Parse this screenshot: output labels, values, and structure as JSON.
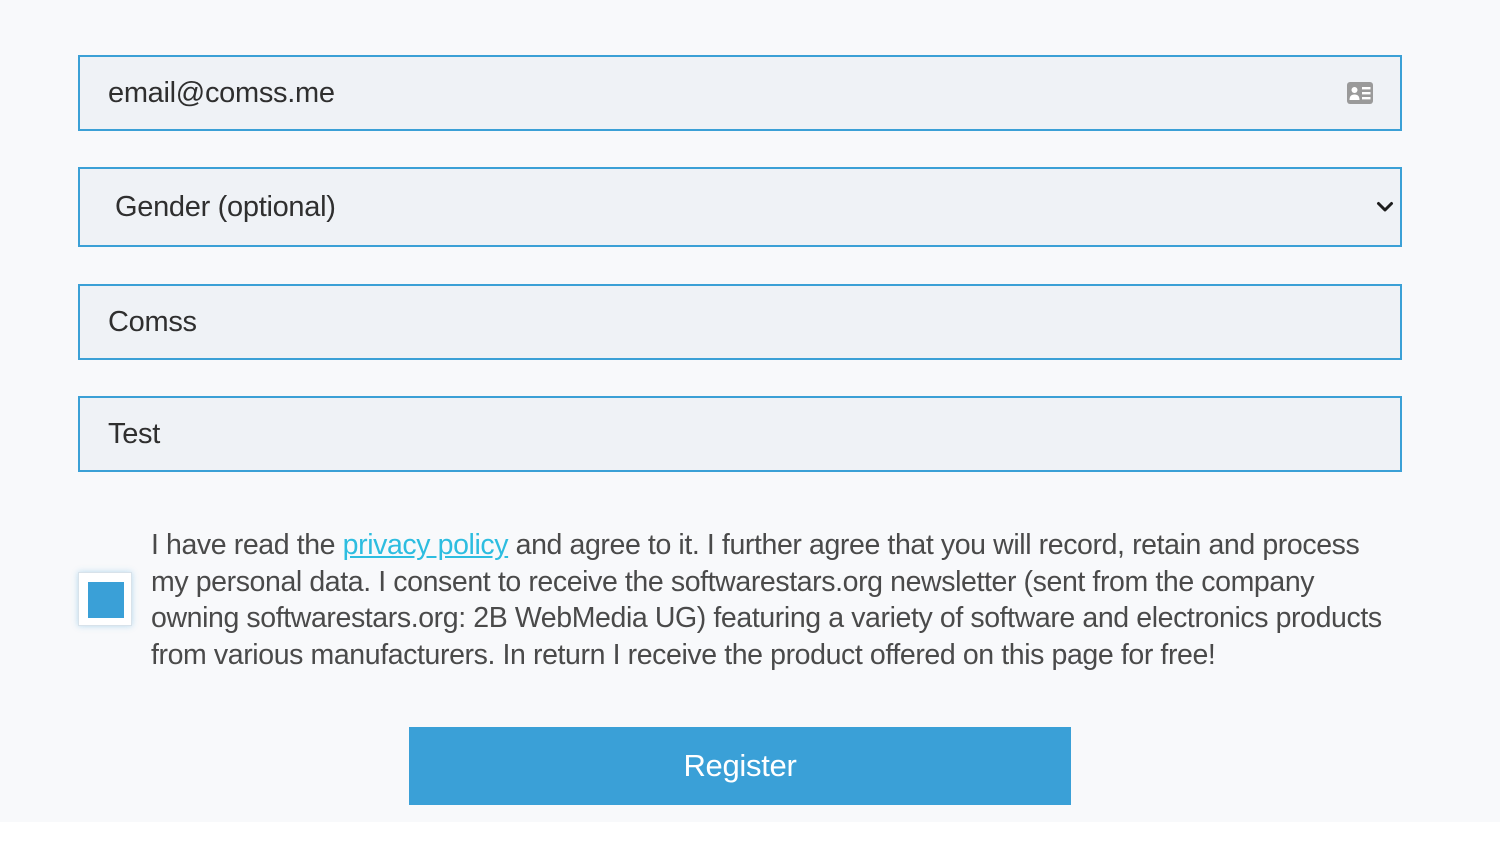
{
  "form": {
    "email": {
      "value": "email@comss.me"
    },
    "gender": {
      "selected": "Gender (optional)"
    },
    "first_name": {
      "value": "Comss"
    },
    "last_name": {
      "value": "Test"
    },
    "consent": {
      "checked": true,
      "text_before": "I have read the ",
      "link_label": "privacy policy",
      "text_after": " and agree to it. I further agree that you will record, retain and process my personal data. I consent to receive the softwarestars.org newsletter (sent from the company owning softwarestars.org: 2B WebMedia UG) featuring a variety of software and electronics products from various manufacturers. In return I receive the product offered on this page for free!"
    },
    "submit_label": "Register"
  },
  "icons": {
    "email_field_icon": "contact-card-icon",
    "gender_field_icon": "chevron-down-icon"
  },
  "colors": {
    "accent": "#3aa0d7",
    "link": "#2dbde0",
    "field_border": "#3ba0d6",
    "field_background": "#eff2f6",
    "page_background": "#f8f9fb"
  }
}
